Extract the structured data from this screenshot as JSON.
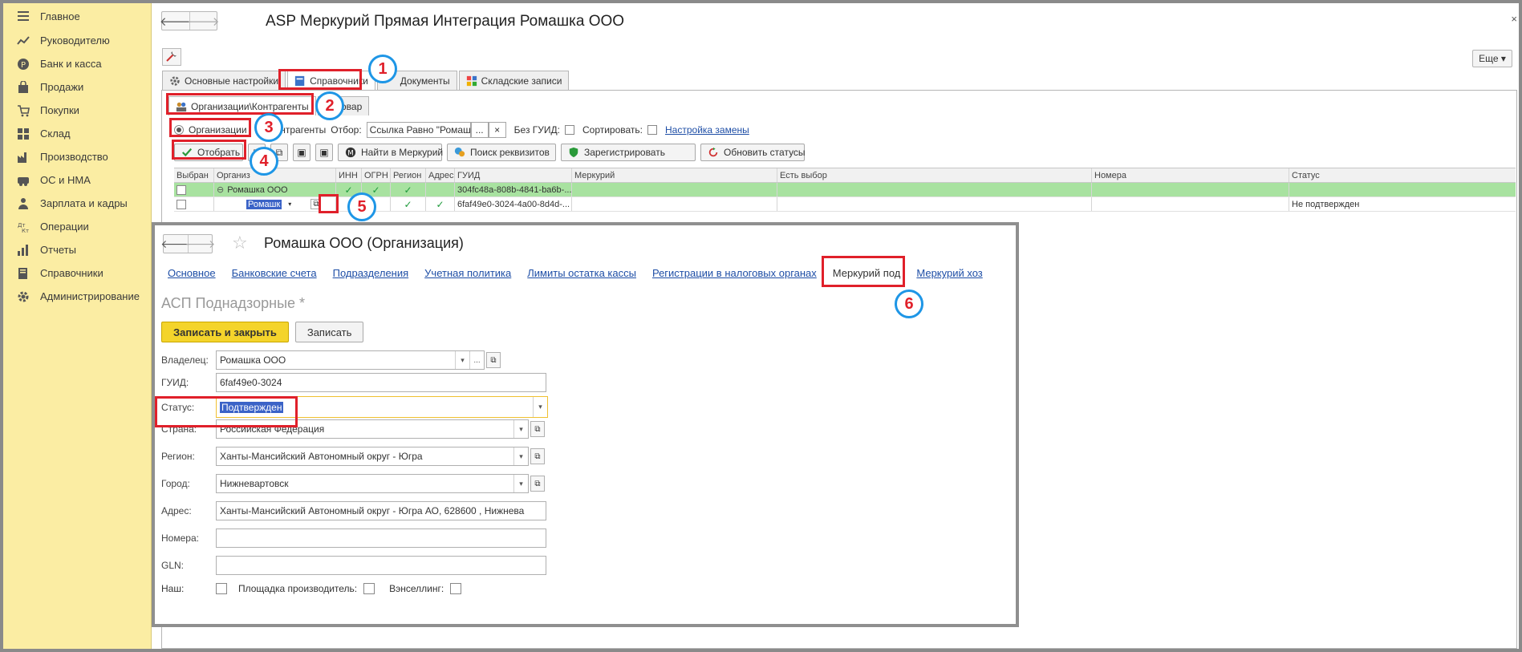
{
  "sidebar": {
    "items": [
      {
        "label": "Главное",
        "icon": "menu-icon"
      },
      {
        "label": "Руководителю",
        "icon": "chart-line-icon"
      },
      {
        "label": "Банк и касса",
        "icon": "coin-icon"
      },
      {
        "label": "Продажи",
        "icon": "shopping-bag-icon"
      },
      {
        "label": "Покупки",
        "icon": "cart-icon"
      },
      {
        "label": "Склад",
        "icon": "warehouse-icon"
      },
      {
        "label": "Производство",
        "icon": "factory-icon"
      },
      {
        "label": "ОС и НМА",
        "icon": "assets-icon"
      },
      {
        "label": "Зарплата и кадры",
        "icon": "person-icon"
      },
      {
        "label": "Операции",
        "icon": "dt-kt-icon"
      },
      {
        "label": "Отчеты",
        "icon": "report-icon"
      },
      {
        "label": "Справочники",
        "icon": "book-icon"
      },
      {
        "label": "Администрирование",
        "icon": "gear-icon"
      }
    ]
  },
  "header": {
    "title": "ASP Меркурий Прямая Интеграция Ромашка ООО",
    "more_label": "Еще",
    "close": "×"
  },
  "main_tabs": [
    {
      "label": "Основные настройки"
    },
    {
      "label": "Справочники"
    },
    {
      "label": "Документы"
    },
    {
      "label": "Складские записи"
    }
  ],
  "sub_tabs": [
    {
      "label": "Организации\\Контрагенты"
    },
    {
      "label": "Товар"
    }
  ],
  "filter": {
    "radio1": "Организации",
    "radio2": "Контрагенты",
    "filter_label": "Отбор:",
    "filter_value": "Ссылка Равно \"Ромашк",
    "dots": "...",
    "clear": "×",
    "no_guid_label": "Без ГУИД:",
    "sort_label": "Сортировать:",
    "replace_link": "Настройка замены"
  },
  "buttons": {
    "select": "Отобрать",
    "find_mercury": "Найти в Меркурий",
    "search_requisites": "Поиск реквизитов",
    "register": "Зарегистрировать",
    "update_statuses": "Обновить статусы"
  },
  "grid": {
    "headers": [
      "Выбран",
      "Организ",
      "ИНН",
      "ОГРН",
      "Регион",
      "Адрес",
      "ГУИД",
      "Меркурий",
      "Есть выбор",
      "Номера",
      "Статус"
    ],
    "rows": [
      {
        "name": "Ромашка ООО",
        "inn": "✓",
        "ogrn": "✓",
        "region": "✓",
        "address": "",
        "guid": "304fc48a-808b-4841-ba6b-...",
        "status": ""
      },
      {
        "name": "Ромашк",
        "inn": "",
        "ogrn": "",
        "region": "✓",
        "address": "✓",
        "guid": "6faf49e0-3024-4a00-8d4d-...",
        "status": "Не подтвержден"
      }
    ]
  },
  "popup": {
    "title": "Ромашка ООО (Организация)",
    "tabs": [
      "Основное",
      "Банковские счета",
      "Подразделения",
      "Учетная политика",
      "Лимиты остатка кассы",
      "Регистрации в налоговых органах",
      "Меркурий под",
      "Меркурий хоз"
    ],
    "subtitle": "АСП Поднадзорные *",
    "save_close": "Записать и закрыть",
    "save": "Записать",
    "fields": {
      "owner_label": "Владелец:",
      "owner_value": "Ромашка ООО",
      "guid_label": "ГУИД:",
      "guid_value": "6faf49e0-3024",
      "status_label": "Статус:",
      "status_value": "Подтвержден",
      "country_label": "Страна:",
      "country_value": "Российская Федерация",
      "region_label": "Регион:",
      "region_value": "Ханты-Мансийский Автономный округ - Югра",
      "city_label": "Город:",
      "city_value": "Нижневартовск",
      "address_label": "Адрес:",
      "address_value": "Ханты-Мансийский Автономный округ - Югра АО, 628600 , Нижнева",
      "numbers_label": "Номера:",
      "numbers_value": "",
      "gln_label": "GLN:",
      "gln_value": "",
      "our_label": "Наш:",
      "producer_label": "Площадка производитель:",
      "vanselling_label": "Вэнселлинг:"
    }
  },
  "annotations": [
    "1",
    "2",
    "3",
    "4",
    "5",
    "6"
  ],
  "colors": {
    "sidebar": "#fbeda3",
    "selected_row": "#a8e2a0",
    "accent_yellow": "#f4d42b",
    "annotation_red": "#e0202a",
    "annotation_blue": "#1e96e6"
  }
}
